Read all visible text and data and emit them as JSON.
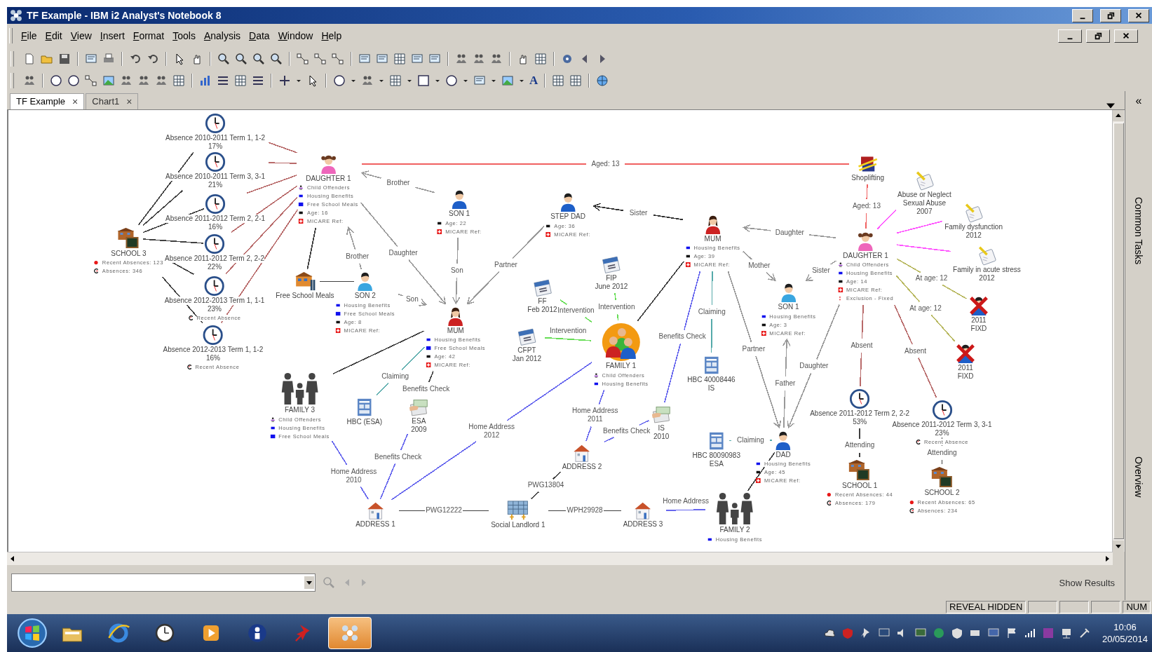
{
  "window": {
    "title": "TF Example - IBM i2 Analyst's Notebook 8"
  },
  "menu": [
    "File",
    "Edit",
    "View",
    "Insert",
    "Format",
    "Tools",
    "Analysis",
    "Data",
    "Window",
    "Help"
  ],
  "format_glyph": "A",
  "tabs": [
    {
      "label": "TF Example",
      "close": "×",
      "selected": true
    },
    {
      "label": "Chart1",
      "close": "×",
      "selected": false
    }
  ],
  "chart": {
    "nodes": [
      {
        "kind": "clock",
        "lines": [
          "Absence 2010-2011 Term 1, 1-2",
          "17%"
        ]
      },
      {
        "kind": "clock",
        "lines": [
          "Absence 2010-2011 Term 3, 3-1",
          "21%"
        ]
      },
      {
        "kind": "clock",
        "lines": [
          "Absence 2011-2012 Term 2, 2-1",
          "16%"
        ]
      },
      {
        "kind": "clock",
        "lines": [
          "Absence 2011-2012 Term 2, 2-2",
          "22%"
        ]
      },
      {
        "kind": "clock",
        "lines": [
          "Absence 2012-2013 Term 1, 1-1",
          "23%"
        ],
        "attributes": [
          {
            "kind": "recent-absence",
            "text": "Recent Absence"
          }
        ]
      },
      {
        "kind": "clock",
        "lines": [
          "Absence 2012-2013 Term 1, 1-2",
          "16%"
        ],
        "attributes": [
          {
            "kind": "recent-absence",
            "text": "Recent Absence"
          }
        ]
      },
      {
        "kind": "school",
        "lines": [
          "SCHOOL 3"
        ],
        "attributes": [
          {
            "kind": "recent-absences",
            "text": "Recent Absences: 123"
          },
          {
            "kind": "absences",
            "text": "Absences: 346"
          }
        ]
      },
      {
        "kind": "girl",
        "lines": [
          "DAUGHTER 1"
        ],
        "attributes": [
          {
            "kind": "child-offenders",
            "text": "Child Offenders"
          },
          {
            "kind": "housing",
            "text": "Housing Benefits"
          },
          {
            "kind": "meals",
            "text": "Free School Meals"
          },
          {
            "kind": "age",
            "text": "Age: 16"
          },
          {
            "kind": "micare",
            "text": "MICARE Ref:"
          }
        ]
      },
      {
        "kind": "man",
        "lines": [
          "SON 1"
        ],
        "attributes": [
          {
            "kind": "age",
            "text": "Age: 22"
          },
          {
            "kind": "micare",
            "text": "MICARE Ref:"
          }
        ]
      },
      {
        "kind": "building",
        "lines": [
          "Free School Meals"
        ]
      },
      {
        "kind": "boy",
        "lines": [
          "SON 2"
        ],
        "attributes": [
          {
            "kind": "housing",
            "text": "Housing Benefits"
          },
          {
            "kind": "meals",
            "text": "Free School Meals"
          },
          {
            "kind": "age",
            "text": "Age: 8"
          },
          {
            "kind": "micare",
            "text": "MICARE Ref:"
          }
        ]
      },
      {
        "kind": "woman",
        "lines": [
          "MUM"
        ],
        "attributes": [
          {
            "kind": "housing",
            "text": "Housing Benefits"
          },
          {
            "kind": "meals",
            "text": "Free School Meals"
          },
          {
            "kind": "age",
            "text": "Age: 42"
          },
          {
            "kind": "micare",
            "text": "MICARE Ref:"
          }
        ]
      },
      {
        "kind": "man",
        "lines": [
          "STEP DAD"
        ],
        "attributes": [
          {
            "kind": "age",
            "text": "Age: 36"
          },
          {
            "kind": "micare",
            "text": "MICARE Ref:"
          }
        ]
      },
      {
        "kind": "woman",
        "lines": [
          "MUM"
        ],
        "attributes": [
          {
            "kind": "housing",
            "text": "Housing Benefits"
          },
          {
            "kind": "age",
            "text": "Age: 39"
          },
          {
            "kind": "micare",
            "text": "MICARE Ref:"
          }
        ]
      },
      {
        "kind": "calendar",
        "lines": [
          "FIP",
          "June 2012"
        ]
      },
      {
        "kind": "calendar",
        "lines": [
          "FF",
          "Feb 2012"
        ]
      },
      {
        "kind": "calendar",
        "lines": [
          "CFPT",
          "Jan 2012"
        ]
      },
      {
        "kind": "family-circle",
        "lines": [
          "FAMILY 1"
        ],
        "attributes": [
          {
            "kind": "child-offenders",
            "text": "Child Offenders"
          },
          {
            "kind": "housing",
            "text": "Housing Benefits"
          }
        ]
      },
      {
        "kind": "family",
        "lines": [
          "FAMILY 3"
        ],
        "attributes": [
          {
            "kind": "child-offenders",
            "text": "Child Offenders"
          },
          {
            "kind": "housing",
            "text": "Housing Benefits"
          },
          {
            "kind": "meals",
            "text": "Free School Meals"
          }
        ]
      },
      {
        "kind": "document",
        "lines": [
          "HBC (ESA)"
        ]
      },
      {
        "kind": "money",
        "lines": [
          "ESA",
          "2009"
        ]
      },
      {
        "kind": "document",
        "lines": [
          "HBC 40008446",
          "IS"
        ]
      },
      {
        "kind": "money",
        "lines": [
          "IS",
          "2010"
        ]
      },
      {
        "kind": "house",
        "lines": [
          "ADDRESS 2"
        ]
      },
      {
        "kind": "house",
        "lines": [
          "ADDRESS 1"
        ]
      },
      {
        "kind": "office",
        "lines": [
          "Social Landlord 1"
        ]
      },
      {
        "kind": "house",
        "lines": [
          "ADDRESS 3"
        ]
      },
      {
        "kind": "family",
        "lines": [
          "FAMILY 2"
        ],
        "attributes": [
          {
            "kind": "housing",
            "text": "Housing Benefits"
          }
        ]
      },
      {
        "kind": "document",
        "lines": [
          "HBC 80090983",
          "ESA"
        ]
      },
      {
        "kind": "boy",
        "lines": [
          "SON 1"
        ],
        "attributes": [
          {
            "kind": "housing",
            "text": "Housing Benefits"
          },
          {
            "kind": "age",
            "text": "Age: 3"
          },
          {
            "kind": "micare",
            "text": "MICARE Ref:"
          }
        ]
      },
      {
        "kind": "man",
        "lines": [
          "DAD"
        ],
        "attributes": [
          {
            "kind": "housing",
            "text": "Housing Benefits"
          },
          {
            "kind": "age",
            "text": "Age: 45"
          },
          {
            "kind": "micare",
            "text": "MICARE Ref:"
          }
        ]
      },
      {
        "kind": "crime",
        "lines": [
          "Shoplifting"
        ]
      },
      {
        "kind": "girl",
        "lines": [
          "DAUGHTER 1"
        ],
        "attributes": [
          {
            "kind": "child-offenders",
            "text": "Child Offenders"
          },
          {
            "kind": "housing",
            "text": "Housing Benefits"
          },
          {
            "kind": "age",
            "text": "Age: 14"
          },
          {
            "kind": "micare",
            "text": "MICARE Ref:"
          },
          {
            "kind": "exclusion",
            "text": "Exclusion - Fixed"
          }
        ]
      },
      {
        "kind": "note",
        "lines": [
          "Abuse or Neglect",
          "Sexual Abuse",
          "2007"
        ]
      },
      {
        "kind": "note",
        "lines": [
          "Family dysfunction",
          "2012"
        ]
      },
      {
        "kind": "note",
        "lines": [
          "Family in acute stress",
          "2012"
        ]
      },
      {
        "kind": "crossed-person",
        "lines": [
          "2011",
          "FIXD"
        ]
      },
      {
        "kind": "crossed-person",
        "lines": [
          "2011",
          "FIXD"
        ]
      },
      {
        "kind": "clock",
        "lines": [
          "Absence 2011-2012 Term 2, 2-2",
          "53%"
        ]
      },
      {
        "kind": "clock",
        "lines": [
          "Absence 2011-2012 Term 3, 3-1",
          "23%"
        ],
        "attributes": [
          {
            "kind": "recent-absence",
            "text": "Recent Absence"
          }
        ]
      },
      {
        "kind": "school",
        "lines": [
          "SCHOOL 1"
        ],
        "attributes": [
          {
            "kind": "recent-absences",
            "text": "Recent Absences: 44"
          },
          {
            "kind": "absences",
            "text": "Absences: 179"
          }
        ]
      },
      {
        "kind": "school",
        "lines": [
          "SCHOOL 2"
        ],
        "attributes": [
          {
            "kind": "recent-absences",
            "text": "Recent Absences: 65"
          },
          {
            "kind": "absences",
            "text": "Absences: 234"
          }
        ]
      }
    ],
    "links": [
      {
        "color": "#b86a6a",
        "arrow": false
      },
      {
        "color": "#b86a6a",
        "arrow": false
      },
      {
        "color": "#b86a6a",
        "arrow": false
      },
      {
        "color": "#b86a6a",
        "arrow": false
      },
      {
        "color": "#b86a6a",
        "arrow": false
      },
      {
        "color": "#b86a6a",
        "arrow": false
      },
      {
        "color": "#404040",
        "arrow": false
      },
      {
        "color": "#404040",
        "arrow": false
      },
      {
        "color": "#404040",
        "arrow": false
      },
      {
        "color": "#404040",
        "arrow": false
      },
      {
        "color": "#404040",
        "arrow": false
      },
      {
        "color": "#404040",
        "arrow": false
      },
      {
        "color": "#f06060",
        "arrow": false,
        "label": [
          "Aged: 13"
        ]
      },
      {
        "color": "#999999",
        "arrow": true,
        "label": [
          "Brother"
        ]
      },
      {
        "color": "#999999",
        "arrow": true,
        "label": [
          "Brother"
        ]
      },
      {
        "color": "#999999",
        "arrow": true,
        "label": [
          "Daughter"
        ]
      },
      {
        "color": "#999999",
        "arrow": true,
        "label": [
          "Son"
        ]
      },
      {
        "color": "#999999",
        "arrow": true,
        "label": [
          "Son"
        ]
      },
      {
        "color": "#999999",
        "arrow": true,
        "label": [
          "Partner"
        ]
      },
      {
        "color": "#303030",
        "arrow": true,
        "label": [
          "Sister"
        ]
      },
      {
        "color": "#999999",
        "arrow": true,
        "label": [
          "Daughter"
        ]
      },
      {
        "color": "#999999",
        "arrow": true,
        "label": [
          "Mother"
        ]
      },
      {
        "color": "#999999",
        "arrow": true,
        "label": [
          "Sister"
        ]
      },
      {
        "color": "#999999",
        "arrow": true,
        "label": [
          "Partner"
        ]
      },
      {
        "color": "#999999",
        "arrow": true,
        "label": [
          "Father"
        ]
      },
      {
        "color": "#999999",
        "arrow": true,
        "label": [
          "Daughter"
        ]
      },
      {
        "color": "#404040",
        "arrow": false
      },
      {
        "color": "#404040",
        "arrow": false
      },
      {
        "color": "#404040",
        "arrow": false
      },
      {
        "color": "#55aaaa",
        "arrow": false,
        "label": [
          "Claiming"
        ]
      },
      {
        "color": "#404040",
        "arrow": false,
        "label": [
          "Benefits Check"
        ]
      },
      {
        "color": "#66dd55",
        "arrow": false,
        "label": [
          "Intervention"
        ]
      },
      {
        "color": "#66dd55",
        "arrow": false,
        "label": [
          "Intervention"
        ]
      },
      {
        "color": "#66dd55",
        "arrow": false,
        "label": [
          "Intervention"
        ]
      },
      {
        "color": "#404040",
        "arrow": false
      },
      {
        "color": "#55aaaa",
        "arrow": false,
        "label": [
          "Claiming"
        ]
      },
      {
        "color": "#6666ee",
        "arrow": false,
        "label": [
          "Benefits Check"
        ]
      },
      {
        "color": "#6666ee",
        "arrow": false,
        "label": [
          "Home Address",
          "2010"
        ]
      },
      {
        "color": "#6666ee",
        "arrow": false,
        "label": [
          "Benefits Check"
        ]
      },
      {
        "color": "#6666ee",
        "arrow": false,
        "label": [
          "Home Address",
          "2012"
        ]
      },
      {
        "color": "#6666ee",
        "arrow": false,
        "label": [
          "Home Address",
          "2011"
        ]
      },
      {
        "color": "#6666ee",
        "arrow": false,
        "label": [
          "Benefits Check"
        ]
      },
      {
        "color": "#404040",
        "arrow": false,
        "label": [
          "PWG12222"
        ]
      },
      {
        "color": "#404040",
        "arrow": false,
        "label": [
          "PWG13804"
        ]
      },
      {
        "color": "#404040",
        "arrow": false,
        "label": [
          "WPH29928"
        ]
      },
      {
        "color": "#6666ee",
        "arrow": false,
        "label": [
          "Home Address"
        ]
      },
      {
        "color": "#55aaaa",
        "arrow": false,
        "label": [
          "Claiming"
        ]
      },
      {
        "color": "#404040",
        "arrow": false
      },
      {
        "color": "#f06060",
        "arrow": false,
        "label": [
          "Aged: 13"
        ]
      },
      {
        "color": "#ff55ff",
        "arrow": false
      },
      {
        "color": "#ff55ff",
        "arrow": false
      },
      {
        "color": "#ff55ff",
        "arrow": false
      },
      {
        "color": "#b8b860",
        "arrow": false,
        "label": [
          "At age: 12"
        ]
      },
      {
        "color": "#b8b860",
        "arrow": false,
        "label": [
          "At age: 12"
        ]
      },
      {
        "color": "#b86a6a",
        "arrow": false,
        "label": [
          "Absent"
        ]
      },
      {
        "color": "#b86a6a",
        "arrow": false,
        "label": [
          "Absent"
        ]
      },
      {
        "color": "#404040",
        "arrow": false,
        "label": [
          "Attending"
        ]
      },
      {
        "color": "#404040",
        "arrow": false,
        "label": [
          "Attending"
        ]
      }
    ]
  },
  "side_panel": {
    "collapse": "«",
    "sections": [
      "Common Tasks",
      "Overview"
    ]
  },
  "search": {
    "results_label": "Show Results"
  },
  "status_bar": {
    "cells": [
      "REVEAL HIDDEN",
      "NUM"
    ]
  },
  "taskbar": {
    "items": [
      {
        "kind": "folder",
        "selected": false
      },
      {
        "kind": "browser",
        "selected": false
      },
      {
        "kind": "clock",
        "selected": false
      },
      {
        "kind": "media",
        "selected": false
      },
      {
        "kind": "person",
        "selected": false
      },
      {
        "kind": "pin",
        "selected": false
      },
      {
        "kind": "app",
        "selected": true
      }
    ],
    "time": "10:06",
    "date": "20/05/2014"
  }
}
